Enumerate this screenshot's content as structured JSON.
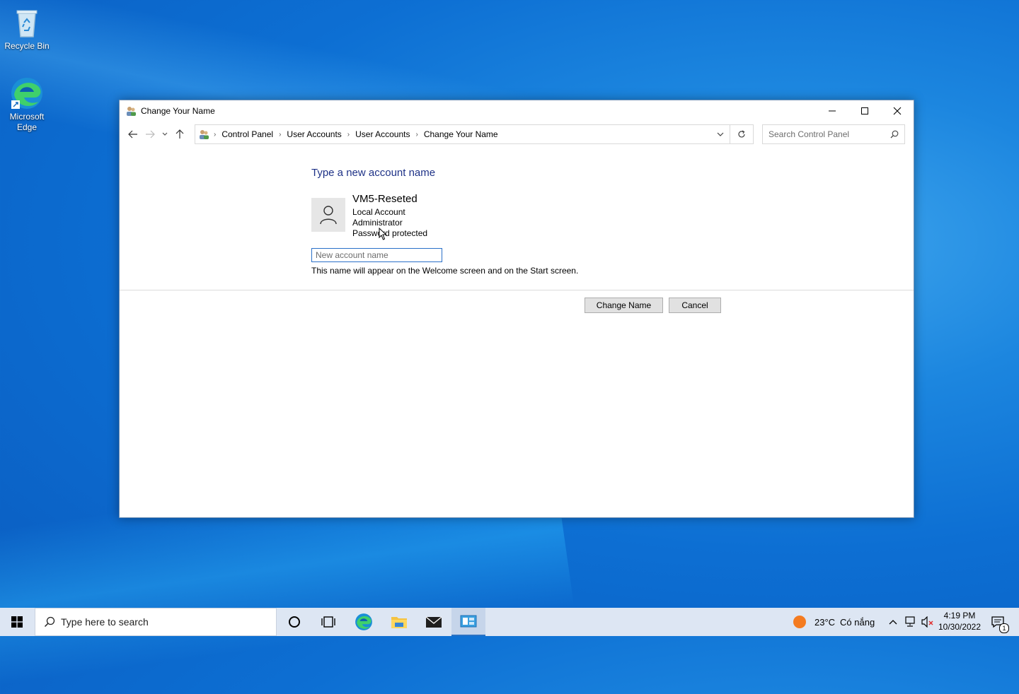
{
  "desktop": {
    "icons": [
      {
        "label": "Recycle Bin",
        "icon": "recycle-bin-icon"
      },
      {
        "label": "Microsoft Edge",
        "icon": "edge-icon"
      }
    ]
  },
  "window": {
    "title": "Change Your Name",
    "controls": {
      "minimize": "minimize-icon",
      "maximize": "maximize-icon",
      "close": "close-icon"
    },
    "breadcrumb": [
      "Control Panel",
      "User Accounts",
      "User Accounts",
      "Change Your Name"
    ],
    "search_placeholder": "Search Control Panel",
    "heading": "Type a new account name",
    "account": {
      "name": "VM5-Reseted",
      "type": "Local Account",
      "role": "Administrator",
      "security": "Password protected"
    },
    "input_placeholder": "New account name",
    "hint": "This name will appear on the Welcome screen and on the Start screen.",
    "buttons": {
      "change": "Change Name",
      "cancel": "Cancel"
    }
  },
  "taskbar": {
    "search_text": "Type here to search",
    "weather": {
      "temp": "23°C",
      "condition": "Có nắng"
    },
    "clock": {
      "time": "4:19 PM",
      "date": "10/30/2022"
    },
    "notification_count": "1"
  },
  "colors": {
    "accent": "#2a72c4",
    "heading": "#1e3287"
  }
}
